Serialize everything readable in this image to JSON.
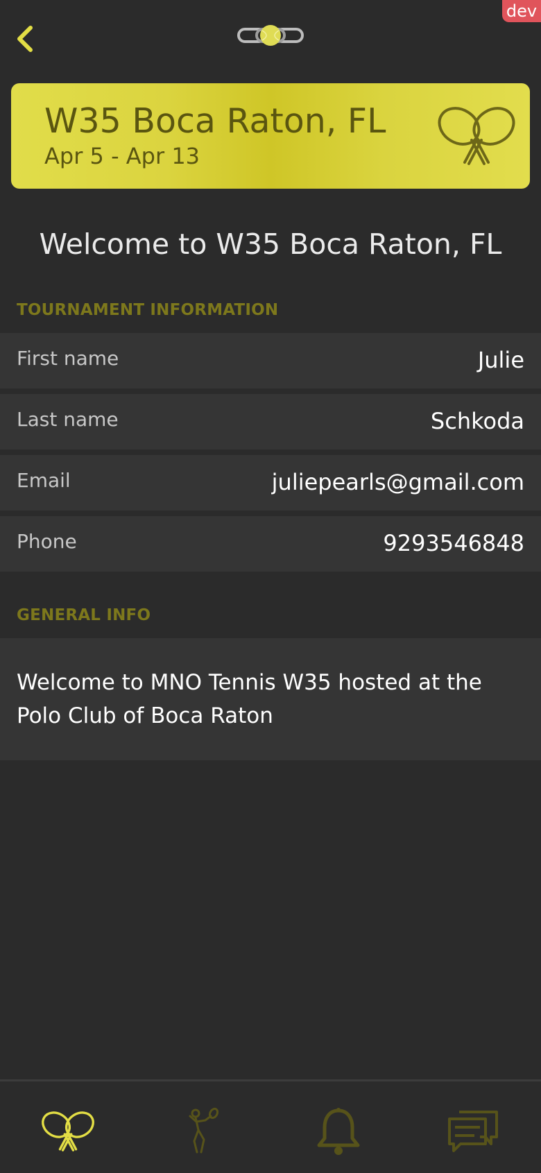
{
  "dev_badge": "dev",
  "header": {
    "back_icon": "chevron-left-icon",
    "logo_icon": "chain-tennis-ball-logo"
  },
  "banner": {
    "title": "W35 Boca Raton, FL",
    "dates": "Apr 5 - Apr 13",
    "icon": "crossed-rackets-icon"
  },
  "welcome": "Welcome to W35 Boca Raton, FL",
  "tournament_info": {
    "header": "TOURNAMENT INFORMATION",
    "rows": [
      {
        "label": "First name",
        "value": "Julie"
      },
      {
        "label": "Last name",
        "value": "Schkoda"
      },
      {
        "label": "Email",
        "value": "juliepearls@gmail.com"
      },
      {
        "label": "Phone",
        "value": "9293546848"
      }
    ]
  },
  "general_info": {
    "header": "GENERAL INFO",
    "text": "Welcome to MNO Tennis W35 hosted at the Polo Club of Boca Raton"
  },
  "tabbar": {
    "tabs": [
      {
        "icon": "crossed-rackets-icon",
        "active": true
      },
      {
        "icon": "tennis-player-icon",
        "active": false
      },
      {
        "icon": "bell-icon",
        "active": false
      },
      {
        "icon": "chat-bubbles-icon",
        "active": false
      }
    ]
  },
  "colors": {
    "background": "#2b2b2b",
    "row_background": "#353535",
    "accent": "#e3de45",
    "banner_text": "#5a5510",
    "section_header": "#7d781c",
    "tab_inactive": "#57531a",
    "dev_badge": "#e0545b"
  }
}
